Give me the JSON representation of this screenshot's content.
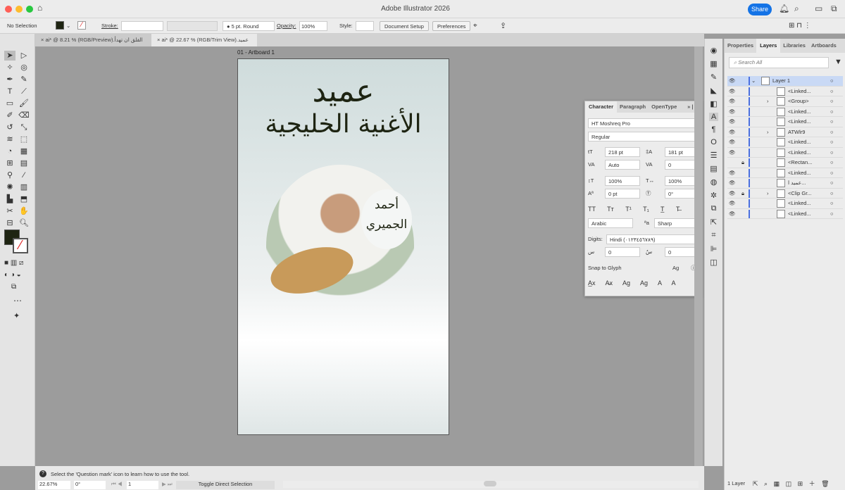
{
  "app": {
    "title": "Adobe Illustrator 2026",
    "share": "Share"
  },
  "control": {
    "selection": "No Selection",
    "stroke_label": "Stroke:",
    "brush": "5 pt. Round",
    "opacity_label": "Opacity:",
    "opacity": "100%",
    "style_label": "Style:",
    "document_setup": "Document Setup",
    "preferences": "Preferences"
  },
  "tabs": [
    {
      "label": "ai* @ 8.21 % (RGB/Preview).القلق ان تهدأ"
    },
    {
      "label": "ai* @ 22.67 % (RGB/Trim View).عميد"
    }
  ],
  "artboard": {
    "label": "01 - Artboard 1",
    "title1": "عميد",
    "title2": "الأغنية الخليجية",
    "name": "أحمد الجميري",
    "colors": {
      "text": "#1e2412"
    }
  },
  "character": {
    "tabs": [
      "Character",
      "Paragraph",
      "OpenType"
    ],
    "font": "HT Moshreq Pro",
    "style": "Regular",
    "size": "218 pt",
    "leading": "181 pt",
    "kerning": "Auto",
    "tracking": "0",
    "vscale": "100%",
    "hscale": "100%",
    "baseline": "0 pt",
    "rotation": "0°",
    "language": "Arabic",
    "aa": "Sharp",
    "digits_label": "Digits:",
    "digits": "Hindi (٠١٢٣٤٥٦٧٨٩)",
    "kashida1": "0",
    "kashida2": "0",
    "snap": "Snap to Glyph"
  },
  "layers": {
    "tabs": [
      "Properties",
      "Layers",
      "Libraries",
      "Artboards"
    ],
    "search_placeholder": "Search All",
    "items": [
      {
        "name": "Layer 1",
        "eye": true,
        "lock": false,
        "expand": "open",
        "level": 0
      },
      {
        "name": "<Linked...",
        "eye": true,
        "lock": false,
        "expand": "",
        "level": 1
      },
      {
        "name": "<Group>",
        "eye": true,
        "lock": false,
        "expand": "closed",
        "level": 1
      },
      {
        "name": "<Linked...",
        "eye": true,
        "lock": false,
        "expand": "",
        "level": 1
      },
      {
        "name": "<Linked...",
        "eye": true,
        "lock": false,
        "expand": "",
        "level": 1
      },
      {
        "name": "ATWlr9",
        "eye": true,
        "lock": false,
        "expand": "closed",
        "level": 1
      },
      {
        "name": "<Linked...",
        "eye": true,
        "lock": false,
        "expand": "",
        "level": 1
      },
      {
        "name": "<Linked...",
        "eye": true,
        "lock": false,
        "expand": "",
        "level": 1
      },
      {
        "name": "<Rectan...",
        "eye": false,
        "lock": true,
        "expand": "",
        "level": 1
      },
      {
        "name": "<Linked...",
        "eye": true,
        "lock": false,
        "expand": "",
        "level": 1
      },
      {
        "name": "عميد ا...",
        "eye": true,
        "lock": false,
        "expand": "",
        "level": 1
      },
      {
        "name": "<Clip Gr...",
        "eye": true,
        "lock": true,
        "expand": "closed",
        "level": 1
      },
      {
        "name": "<Linked...",
        "eye": true,
        "lock": false,
        "expand": "",
        "level": 1
      },
      {
        "name": "<Linked...",
        "eye": true,
        "lock": false,
        "expand": "",
        "level": 1
      }
    ],
    "count": "1 Layer"
  },
  "status": {
    "hint": "Select the 'Question mark' icon to learn how to use the tool.",
    "zoom": "22.67%",
    "rotation": "0°",
    "artboard": "1",
    "tool": "Toggle Direct Selection"
  }
}
